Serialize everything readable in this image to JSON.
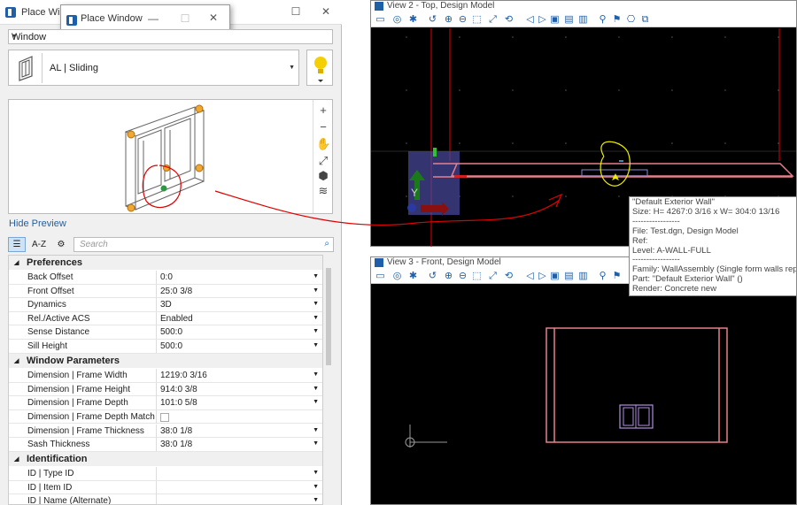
{
  "panel": {
    "title": "Place Window",
    "type_value": "Window",
    "style_value": "AL | Sliding",
    "hide_preview": "Hide Preview",
    "search_placeholder": "Search",
    "sort_az": "A-Z"
  },
  "floating_window": {
    "title": "Place Window"
  },
  "properties": {
    "categories": [
      {
        "name": "Preferences",
        "rows": [
          {
            "name": "Back Offset",
            "value": "0:0"
          },
          {
            "name": "Front Offset",
            "value": "25:0 3/8"
          },
          {
            "name": "Dynamics",
            "value": "3D"
          },
          {
            "name": "Rel./Active ACS",
            "value": "Enabled"
          },
          {
            "name": "Sense Distance",
            "value": "500:0"
          },
          {
            "name": "Sill Height",
            "value": "500:0"
          }
        ]
      },
      {
        "name": "Window Parameters",
        "rows": [
          {
            "name": "Dimension | Frame Width",
            "value": "1219:0 3/16"
          },
          {
            "name": "Dimension | Frame Height",
            "value": "914:0 3/8"
          },
          {
            "name": "Dimension | Frame Depth",
            "value": "101:0 5/8"
          },
          {
            "name": "Dimension | Frame Depth Match Wall",
            "value": ""
          },
          {
            "name": "Dimension | Frame Thickness",
            "value": "38:0 1/8"
          },
          {
            "name": "Sash Thickness",
            "value": "38:0 1/8"
          }
        ]
      },
      {
        "name": "Identification",
        "rows": [
          {
            "name": "ID | Type ID",
            "value": ""
          },
          {
            "name": "ID | Item ID",
            "value": ""
          },
          {
            "name": "ID | Name (Alternate)",
            "value": ""
          }
        ]
      }
    ]
  },
  "view2": {
    "title": "View 2 - Top, Design Model"
  },
  "view3": {
    "title": "View 3 - Front, Design Model"
  },
  "tooltip": {
    "lines": [
      "\"Default Exterior Wall\"",
      "Size: H= 4267:0 3/16 x W= 304:0 13/16",
      "-----------------",
      "File: Test.dgn, Design Model",
      "Ref:",
      "Level: A-WALL-FULL",
      "-----------------",
      "Family: WallAssembly (Single form walls represe",
      "Part: \"Default Exterior Wall\" ()",
      "Render: Concrete new"
    ]
  },
  "colors": {
    "wall": "#e8808c",
    "accent": "#1f5fa8",
    "view_bg": "#000000",
    "annotation": "#e00000",
    "highlight": "#f0f000"
  }
}
